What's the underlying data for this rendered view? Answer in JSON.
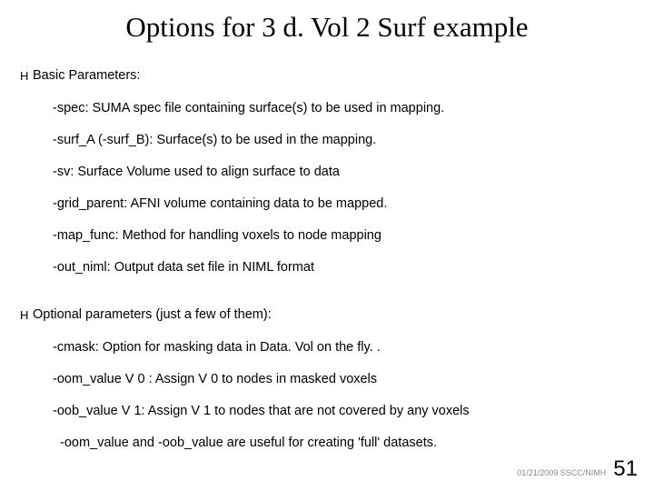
{
  "title": "Options for 3 d. Vol 2 Surf example",
  "sections": [
    {
      "bullet": "H",
      "label": "Basic Parameters:",
      "items": [
        "-spec: SUMA spec file containing surface(s) to be used in mapping.",
        "-surf_A (-surf_B): Surface(s) to be used in the mapping.",
        "-sv: Surface Volume used to align surface to data",
        "-grid_parent: AFNI volume containing data to be mapped.",
        "-map_func: Method for handling voxels to node mapping",
        "-out_niml: Output data set file in NIML format"
      ]
    },
    {
      "bullet": "H",
      "label": "Optional parameters (just a few of them):",
      "items": [
        "-cmask: Option for masking data in Data. Vol on the fly. .",
        "-oom_value V 0 : Assign V 0 to nodes in masked voxels",
        "-oob_value V 1: Assign V 1 to nodes that are not covered by any voxels"
      ]
    }
  ],
  "note": "-oom_value and -oob_value are useful for creating 'full' datasets.",
  "footer_text": "01/21/2009 SSCC/NIMH",
  "page_num": "51"
}
